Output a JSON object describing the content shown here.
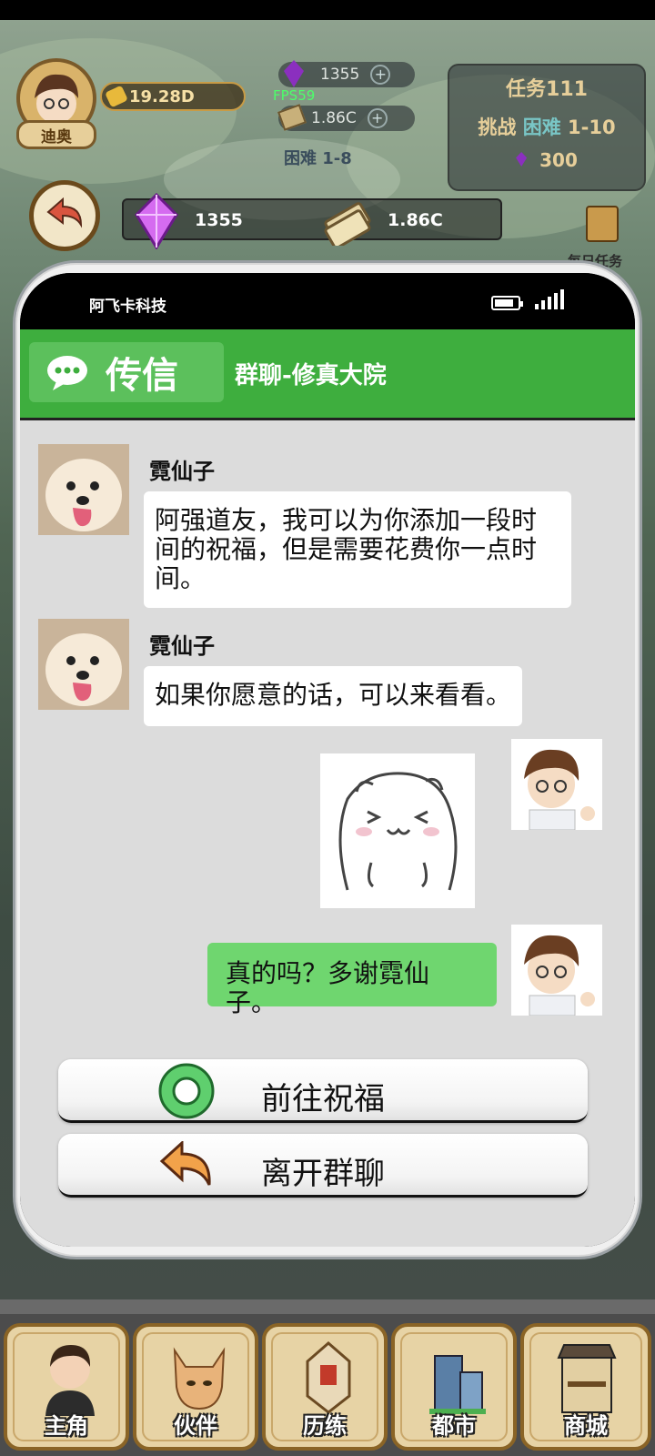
{
  "hud": {
    "player_name": "迪奥",
    "gold": "19.28D",
    "gems_small": "1355",
    "cash_small": "1.86C",
    "fps": "FPS59",
    "difficulty_tag": "困难 1-8",
    "task_title": "任务111",
    "task_line_prefix": "挑战",
    "task_line_highlight": "困难",
    "task_line_suffix": "1-10",
    "task_reward": "300",
    "gems": "1355",
    "cash": "1.86C",
    "daily_task": "每日任务"
  },
  "phone": {
    "carrier": "阿飞卡科技",
    "header_title": "传信",
    "header_subtitle": "群聊-修真大院"
  },
  "messages": [
    {
      "sender": "霓仙子",
      "text": "阿强道友，我可以为你添加一段时间的祝福，但是需要花费你一点时间。"
    },
    {
      "sender": "霓仙子",
      "text": "如果你愿意的话，可以来看看。"
    },
    {
      "sender": "me",
      "type": "sticker"
    },
    {
      "sender": "me",
      "text": "真的吗？多谢霓仙子。"
    }
  ],
  "actions": {
    "go_bless": "前往祝福",
    "leave_chat": "离开群聊"
  },
  "nav": [
    {
      "label": "主角",
      "icon": "protagonist-icon"
    },
    {
      "label": "伙伴",
      "icon": "partner-cat-icon"
    },
    {
      "label": "历练",
      "icon": "training-sign-icon"
    },
    {
      "label": "都市",
      "icon": "city-buildings-icon"
    },
    {
      "label": "商城",
      "icon": "shop-stall-icon"
    }
  ],
  "colors": {
    "header_green": "#3eae3e",
    "my_bubble": "#6fd66f",
    "chat_bg": "#dcdcdc",
    "nav_tile": "#e7d3a5"
  }
}
